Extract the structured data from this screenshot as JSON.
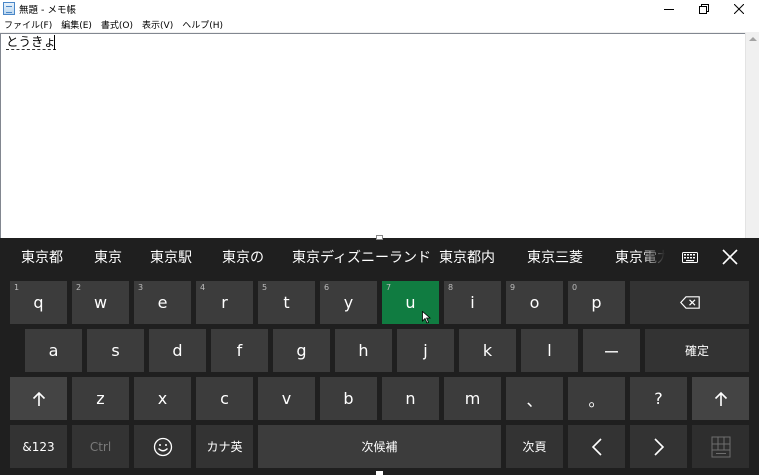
{
  "window": {
    "title": "無題 - メモ帳"
  },
  "menu": [
    {
      "label": "ファイル(F)"
    },
    {
      "label": "編集(E)"
    },
    {
      "label": "書式(O)"
    },
    {
      "label": "表示(V)"
    },
    {
      "label": "ヘルプ(H)"
    }
  ],
  "editor": {
    "text": "とうきょ"
  },
  "candidates": [
    {
      "label": "東京都"
    },
    {
      "label": "東京"
    },
    {
      "label": "東京駅"
    },
    {
      "label": "東京の"
    },
    {
      "label": "東京ディズニーランド"
    },
    {
      "label": "東京都内"
    },
    {
      "label": "東京三菱"
    },
    {
      "label": "東京電力"
    }
  ],
  "icons": {
    "keyboard_settings": "keyboard-icon",
    "close": "close-icon",
    "backspace": "backspace-icon",
    "shift": "shift-arrow-icon",
    "emoji": "emoji-icon",
    "left": "chevron-left-icon",
    "right": "chevron-right-icon",
    "layout": "keyboard-layout-icon"
  },
  "keys": {
    "row1": [
      {
        "num": "1",
        "label": "q"
      },
      {
        "num": "2",
        "label": "w"
      },
      {
        "num": "3",
        "label": "e"
      },
      {
        "num": "4",
        "label": "r"
      },
      {
        "num": "5",
        "label": "t"
      },
      {
        "num": "6",
        "label": "y"
      },
      {
        "num": "7",
        "label": "u"
      },
      {
        "num": "8",
        "label": "i"
      },
      {
        "num": "9",
        "label": "o"
      },
      {
        "num": "0",
        "label": "p"
      }
    ],
    "row2": [
      {
        "label": "a"
      },
      {
        "label": "s"
      },
      {
        "label": "d"
      },
      {
        "label": "f"
      },
      {
        "label": "g"
      },
      {
        "label": "h"
      },
      {
        "label": "j"
      },
      {
        "label": "k"
      },
      {
        "label": "l"
      },
      {
        "label": "ー"
      }
    ],
    "enter": "確定",
    "row3": [
      {
        "label": "z"
      },
      {
        "label": "x"
      },
      {
        "label": "c"
      },
      {
        "label": "v"
      },
      {
        "label": "b"
      },
      {
        "label": "n"
      },
      {
        "label": "m"
      },
      {
        "label": "、"
      },
      {
        "label": "。"
      },
      {
        "label": "?"
      }
    ],
    "sym": "&123",
    "ctrl": "Ctrl",
    "kana": "カナ英",
    "space": "次候補",
    "next_page": "次頁",
    "active_key": "u"
  },
  "colors": {
    "keyboard_bg": "#1f1f1f",
    "key_bg": "#3c3c3c",
    "active_key": "#107c41"
  }
}
